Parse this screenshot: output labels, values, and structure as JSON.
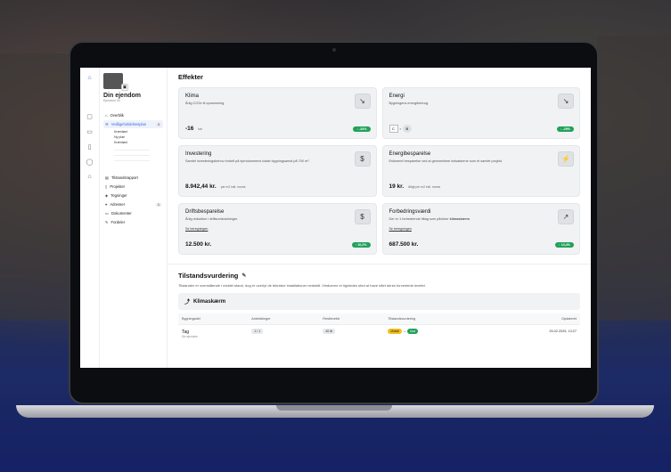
{
  "sidebar": {
    "property_name": "Din ejendom",
    "property_sub": "Ejendom 00",
    "nav": [
      {
        "label": "Overblik",
        "icon": "home-icon"
      },
      {
        "label": "Vedligeholdelsesplan",
        "icon": "tool-icon",
        "badge": "3"
      }
    ],
    "subitems": [
      "Kræntøst",
      "Ny plan",
      "Kræntøst"
    ],
    "nav2": [
      {
        "label": "Tilstandsrapport",
        "icon": "document-icon"
      },
      {
        "label": "Projekter",
        "icon": "bookmark-icon"
      },
      {
        "label": "Tegninger",
        "icon": "layers-icon"
      },
      {
        "label": "Adresser",
        "icon": "pin-icon",
        "badge": "1"
      },
      {
        "label": "Dokumenter",
        "icon": "folder-icon"
      },
      {
        "label": "Fordeler",
        "icon": "pencil-icon"
      }
    ]
  },
  "effekter": {
    "title": "Effekter",
    "cards": [
      {
        "title": "Klima",
        "desc": "Årlig CO2e til opvarmning.",
        "value": "-16",
        "unit": "ton",
        "pill": "↓ -34%",
        "icon": "↘"
      },
      {
        "title": "Energi",
        "desc": "Bygningens energiforbrug.",
        "from": "C",
        "to": "B",
        "pill": "↓ -29%",
        "icon": "↘"
      },
      {
        "title": "Investering",
        "desc": "Samlet investeringsbehov fordelt på ejendommens totale bygningsareal på 700 m².",
        "value": "8.942,44 kr.",
        "unit": "per m2 inkl. moms",
        "icon": "$"
      },
      {
        "title": "Energibesparelse",
        "desc": "Estimeret besparelse ved at gennemføre indsatserne som et samlet projekt.",
        "value": "19 kr.",
        "unit": "årligt per m2 inkl. moms",
        "icon": "⚡"
      },
      {
        "title": "Driftsbesparelse",
        "desc": "Årlig reduktion i driftsomkostninger.",
        "link": "Se beregningen",
        "value": "12.500 kr.",
        "pill": "↑ 10,2%",
        "icon": "$"
      },
      {
        "title": "Forbedringsværdi",
        "desc": "Der er 1 forbedrende tiltag som påvirker",
        "desc_bold": "klimaskærm",
        "link": "Se beregningen",
        "value": "687.500 kr.",
        "pill": "↑ 13,4%",
        "icon": "↗"
      }
    ]
  },
  "tilstand": {
    "title": "Tilstandsvurdering",
    "desc": "Tilstanden er ovenstående i middel stand, dog er overlyt de tekniske installationer nedslidt. Vinduerne er ligeledes sted at have nået deres forventede levetid.",
    "klima_label": "Klimaskærm",
    "columns": [
      "Bygningsdel",
      "Anbefalinger",
      "Restlevetid",
      "Tilstandsvurdering",
      "Opdateret"
    ],
    "row": {
      "name": "Tag",
      "sub": "Din ejendom",
      "anbef": "1 / 1",
      "rest": "40 år",
      "from": "Middel",
      "to": "God",
      "date": "25.02.2025, 13:27"
    }
  }
}
